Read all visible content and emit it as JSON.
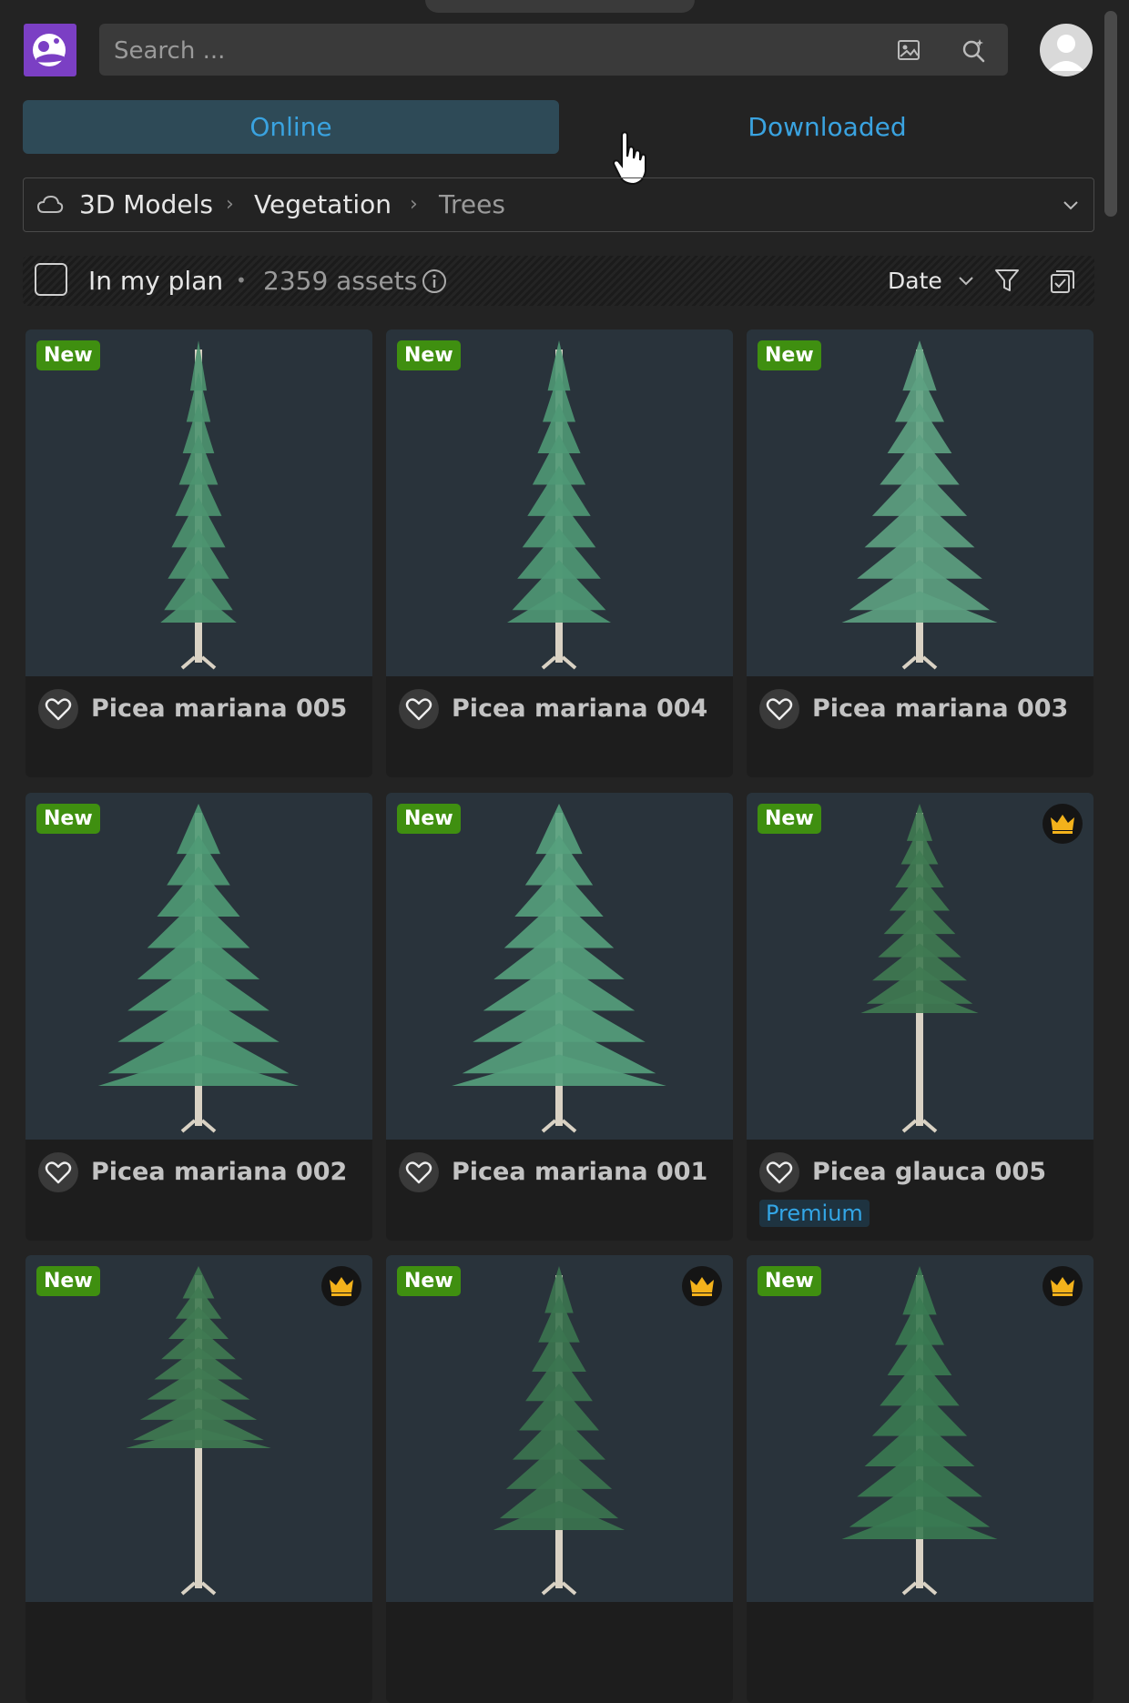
{
  "header": {
    "search_placeholder": "Search ...",
    "icons": [
      "app-logo-icon",
      "image-search-icon",
      "smart-search-icon",
      "user-avatar-icon"
    ]
  },
  "tabs": [
    {
      "label": "Online",
      "active": true
    },
    {
      "label": "Downloaded",
      "active": false
    }
  ],
  "breadcrumb": {
    "items": [
      "3D Models",
      "Vegetation",
      "Trees"
    ],
    "separator": "›"
  },
  "filter_bar": {
    "plan_label": "In my plan",
    "dot": "•",
    "asset_count": "2359 assets",
    "sort_label": "Date"
  },
  "colors": {
    "accent": "#3aa3e0",
    "new_badge": "#3f8f10",
    "brand": "#7b3fc4",
    "crown": "#f3b21b"
  },
  "assets": [
    {
      "name": "Picea mariana 005",
      "badge": "New",
      "premium": false
    },
    {
      "name": "Picea mariana 004",
      "badge": "New",
      "premium": false
    },
    {
      "name": "Picea mariana 003",
      "badge": "New",
      "premium": false
    },
    {
      "name": "Picea mariana 002",
      "badge": "New",
      "premium": false
    },
    {
      "name": "Picea mariana 001",
      "badge": "New",
      "premium": false
    },
    {
      "name": "Picea glauca 005",
      "badge": "New",
      "premium": true,
      "premium_label": "Premium"
    },
    {
      "name": "",
      "badge": "New",
      "premium": true
    },
    {
      "name": "",
      "badge": "New",
      "premium": true
    },
    {
      "name": "",
      "badge": "New",
      "premium": true
    }
  ]
}
